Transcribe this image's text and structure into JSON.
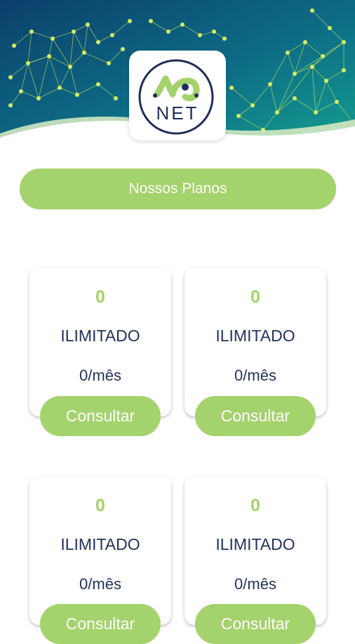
{
  "app": {
    "title": "Nossos Planos",
    "logo_text": "NET"
  },
  "colors": {
    "accent": "#a4d26c",
    "text_dark": "#24325c",
    "header_dark": "#0b3f6b",
    "header_teal": "#0f8a8c"
  },
  "plans": [
    {
      "speed": "0",
      "type": "ILIMITADO",
      "price": "0/mês",
      "button": "Consultar"
    },
    {
      "speed": "0",
      "type": "ILIMITADO",
      "price": "0/mês",
      "button": "Consultar"
    },
    {
      "speed": "0",
      "type": "ILIMITADO",
      "price": "0/mês",
      "button": "Consultar"
    },
    {
      "speed": "0",
      "type": "ILIMITADO",
      "price": "0/mês",
      "button": "Consultar"
    }
  ]
}
